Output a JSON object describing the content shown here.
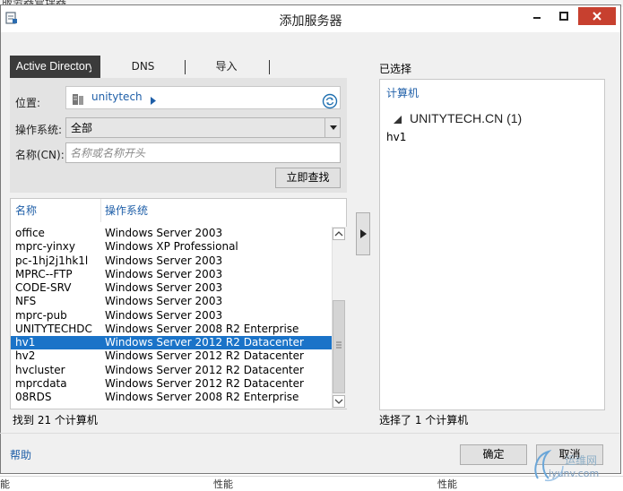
{
  "background": {
    "top_text": "服务器管理器",
    "bottom_cells": [
      "能",
      "性能",
      "性能"
    ]
  },
  "window": {
    "title": "添加服务器",
    "accent": "#c7402f"
  },
  "tabs": [
    {
      "label": "Active Directory",
      "active": true
    },
    {
      "label": "DNS",
      "active": false
    },
    {
      "label": "导入",
      "active": false
    }
  ],
  "filters": {
    "location_label": "位置:",
    "location_value": "unitytech",
    "os_label": "操作系统:",
    "os_value": "全部",
    "name_label": "名称(CN):",
    "name_placeholder": "名称或名称开头",
    "find_button": "立即查找"
  },
  "list": {
    "columns": [
      "名称",
      "操作系统"
    ],
    "rows": [
      {
        "name": "office",
        "os": "Windows Server 2003",
        "selected": false
      },
      {
        "name": "mprc-yinxy",
        "os": "Windows XP Professional",
        "selected": false
      },
      {
        "name": "pc-1hj2j1hk1l",
        "os": "Windows Server 2003",
        "selected": false
      },
      {
        "name": "MPRC--FTP",
        "os": "Windows Server 2003",
        "selected": false
      },
      {
        "name": "CODE-SRV",
        "os": "Windows Server 2003",
        "selected": false
      },
      {
        "name": "NFS",
        "os": "Windows Server 2003",
        "selected": false
      },
      {
        "name": "mprc-pub",
        "os": "Windows Server 2003",
        "selected": false
      },
      {
        "name": "UNITYTECHDC",
        "os": "Windows Server 2008 R2 Enterprise",
        "selected": false
      },
      {
        "name": "hv1",
        "os": "Windows Server 2012 R2 Datacenter",
        "selected": true
      },
      {
        "name": "hv2",
        "os": "Windows Server 2012 R2 Datacenter",
        "selected": false
      },
      {
        "name": "hvcluster",
        "os": "Windows Server 2012 R2 Datacenter",
        "selected": false
      },
      {
        "name": "mprcdata",
        "os": "Windows Server 2012 R2 Datacenter",
        "selected": false
      },
      {
        "name": "08RDS",
        "os": "Windows Server 2008 R2 Enterprise",
        "selected": false
      }
    ],
    "found_text": "找到 21 个计算机"
  },
  "selected_panel": {
    "title": "已选择",
    "header": "计算机",
    "domain": "UNITYTECH.CN (1)",
    "items": [
      "hv1"
    ],
    "count_text": "选择了 1 个计算机"
  },
  "footer": {
    "help": "帮助",
    "ok": "确定",
    "cancel": "取消"
  },
  "watermark": {
    "text1": "运维网",
    "text2": "iyunv.com"
  }
}
